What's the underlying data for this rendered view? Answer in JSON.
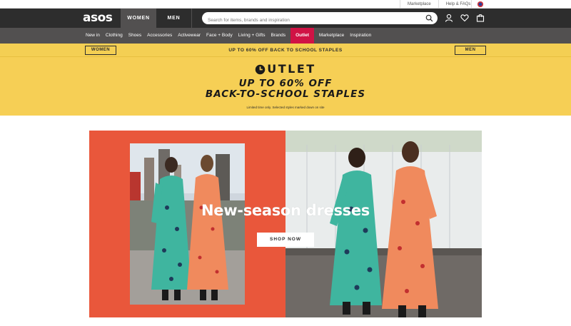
{
  "utility_bar": {
    "links": [
      "Marketplace",
      "Help & FAQs"
    ],
    "flag_icon": "uk-flag-icon"
  },
  "header": {
    "logo": "asos",
    "tabs": [
      {
        "label": "WOMEN",
        "active": true
      },
      {
        "label": "MEN",
        "active": false
      }
    ],
    "search": {
      "placeholder": "Search for items, brands and inspiration",
      "value": ""
    },
    "icons": [
      "account-icon",
      "heart-icon",
      "bag-icon"
    ]
  },
  "nav": {
    "items": [
      {
        "label": "New in"
      },
      {
        "label": "Clothing"
      },
      {
        "label": "Shoes"
      },
      {
        "label": "Accessories"
      },
      {
        "label": "Activewear"
      },
      {
        "label": "Face + Body"
      },
      {
        "label": "Living + Gifts"
      },
      {
        "label": "Brands"
      },
      {
        "label": "Outlet",
        "highlight": true
      },
      {
        "label": "Marketplace"
      },
      {
        "label": "Inspiration"
      }
    ]
  },
  "promo_strip": {
    "left_button": "WOMEN",
    "text": "UP TO 60% OFF BACK TO SCHOOL STAPLES",
    "right_button": "MEN"
  },
  "outlet_banner": {
    "logo_word": "UTLET",
    "headline_line1": "UP TO 60% OFF",
    "headline_line2": "BACK-TO-SCHOOL STAPLES",
    "note": "Limited time only. Selected styles marked down on site"
  },
  "hero": {
    "title": "New-season dresses",
    "cta": "SHOP NOW"
  },
  "colors": {
    "header_bg": "#2d2d2d",
    "nav_bg": "#525050",
    "outlet_red": "#d01345",
    "promo_yellow": "#f6cf55",
    "hero_orange": "#e9573b"
  }
}
